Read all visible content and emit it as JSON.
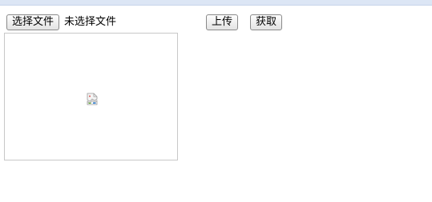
{
  "file_input": {
    "choose_label": "选择文件",
    "status_text": "未选择文件"
  },
  "actions": {
    "upload_label": "上传",
    "fetch_label": "获取"
  },
  "preview": {
    "icon": "broken-image-icon"
  }
}
